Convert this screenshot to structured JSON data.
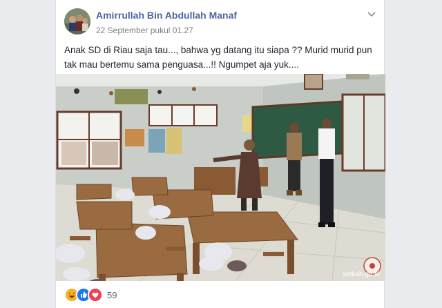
{
  "post": {
    "author": "Amirrullah Bin Abdullah Manaf",
    "timestamp": "22 September pukul 01.27",
    "text": "Anak SD di Riau saja tau..., bahwa yg datang itu siapa ?? Murid murid pun tak mau bertemu sama penguasa...!! Ngumpet aja yuk....",
    "photo_watermark": "setkab.go.id",
    "reaction_count": "59",
    "reaction_icons": [
      "haha-icon",
      "like-icon",
      "love-icon"
    ]
  },
  "colors": {
    "author_link": "#4b67a1",
    "like_blue": "#1877f2",
    "love_red": "#f33e58",
    "haha_yellow": "#f7b125"
  }
}
